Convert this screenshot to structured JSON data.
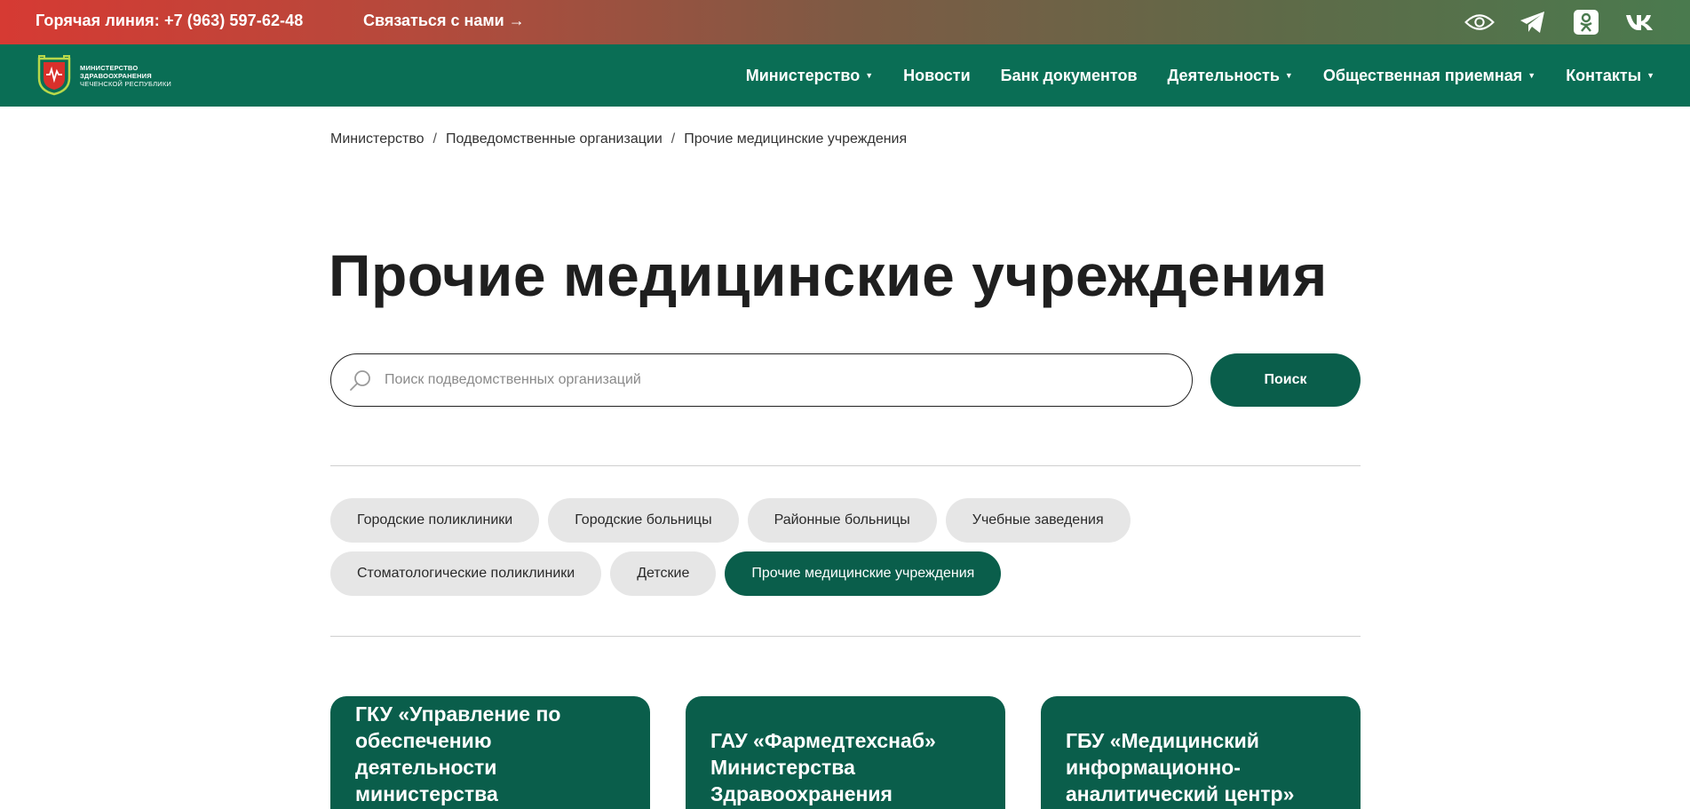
{
  "topbar": {
    "hotline": "Горячая линия: +7 (963) 597-62-48",
    "contact_link": "Связаться с нами →",
    "social": [
      "eye-icon",
      "telegram-icon",
      "odnoklassniki-icon",
      "vk-icon"
    ]
  },
  "logo": {
    "line1": "МИНИСТЕРСТВО",
    "line2": "ЗДРАВООХРАНЕНИЯ",
    "line3": "ЧЕЧЕНСКОЙ РЕСПУБЛИКИ"
  },
  "nav": {
    "items": [
      {
        "label": "Министерство",
        "dropdown": true
      },
      {
        "label": "Новости",
        "dropdown": false
      },
      {
        "label": "Банк документов",
        "dropdown": false
      },
      {
        "label": "Деятельность",
        "dropdown": true
      },
      {
        "label": "Общественная приемная",
        "dropdown": true
      },
      {
        "label": "Контакты",
        "dropdown": true
      }
    ]
  },
  "breadcrumb": {
    "items": [
      "Министерство",
      "Подведомственные организации",
      "Прочие медицинские учреждения"
    ],
    "separator": "/"
  },
  "page_title": "Прочие медицинские учреждения",
  "search": {
    "placeholder": "Поиск подведомственных организаций",
    "value": "",
    "button_label": "Поиск"
  },
  "filters": [
    {
      "label": "Городские поликлиники",
      "active": false
    },
    {
      "label": "Городские больницы",
      "active": false
    },
    {
      "label": "Районные больницы",
      "active": false
    },
    {
      "label": "Учебные заведения",
      "active": false
    },
    {
      "label": "Стоматологические поликлиники",
      "active": false
    },
    {
      "label": "Детские",
      "active": false
    },
    {
      "label": "Прочие медицинские учреждения",
      "active": true
    }
  ],
  "cards": [
    {
      "title": "ГКУ «Управление по обеспечению деятельности министерства здравоохранения"
    },
    {
      "title": "ГАУ «Фармедтехснаб» Министерства Здравоохранения"
    },
    {
      "title": "ГБУ «Медицинский информационно-аналитический центр»"
    }
  ],
  "colors": {
    "primary": "#0a6e55",
    "button": "#0a5e4b",
    "chip": "#e6e6e6",
    "topbar_start": "#d63a33",
    "topbar_end": "#4a7a4e"
  }
}
